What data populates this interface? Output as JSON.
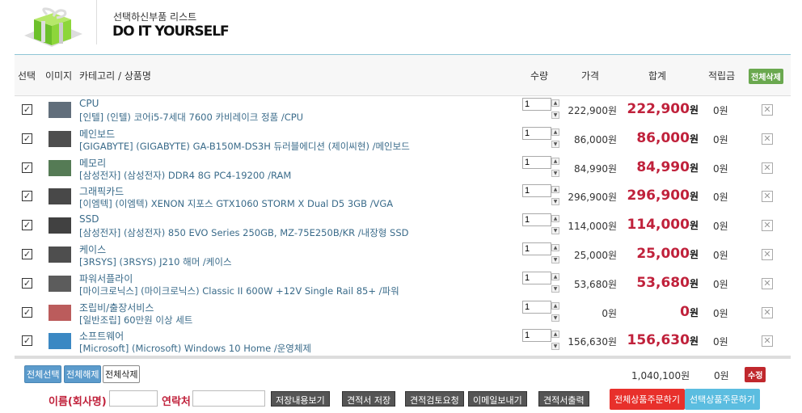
{
  "header": {
    "subtitle": "선택하신부품 리스트",
    "title": "DO IT YOURSELF"
  },
  "columns": {
    "select": "선택",
    "image": "이미지",
    "name": "카테고리 / 상품명",
    "qty": "수량",
    "price": "가격",
    "total": "합계",
    "points": "적립금",
    "delete_all": "전체삭제"
  },
  "items": [
    {
      "category": "CPU",
      "name": "[인텔] (인텔) 코어i5-7세대 7600 카비레이크 정품 /CPU",
      "qty": "1",
      "price": "222,900원",
      "total": "222,900",
      "points": "0원"
    },
    {
      "category": "메인보드",
      "name": "[GIGABYTE] (GIGABYTE) GA-B150M-DS3H 듀러블에디션 (제이씨현) /메인보드",
      "qty": "1",
      "price": "86,000원",
      "total": "86,000",
      "points": "0원"
    },
    {
      "category": "메모리",
      "name": "[삼성전자] (삼성전자) DDR4 8G PC4-19200 /RAM",
      "qty": "1",
      "price": "84,990원",
      "total": "84,990",
      "points": "0원"
    },
    {
      "category": "그래픽카드",
      "name": "[이엠텍] (이엠텍) XENON 지포스 GTX1060 STORM X Dual D5 3GB /VGA",
      "qty": "1",
      "price": "296,900원",
      "total": "296,900",
      "points": "0원"
    },
    {
      "category": "SSD",
      "name": "[삼성전자] (삼성전자) 850 EVO Series 250GB, MZ-75E250B/KR /내장형 SSD",
      "qty": "1",
      "price": "114,000원",
      "total": "114,000",
      "points": "0원"
    },
    {
      "category": "케이스",
      "name": "[3RSYS] (3RSYS) J210 해머 /케이스",
      "qty": "1",
      "price": "25,000원",
      "total": "25,000",
      "points": "0원"
    },
    {
      "category": "파워서플라이",
      "name": "[마이크로닉스] (마이크로닉스) Classic II 600W +12V Single Rail 85+ /파워",
      "qty": "1",
      "price": "53,680원",
      "total": "53,680",
      "points": "0원"
    },
    {
      "category": "조립비/출장서비스",
      "name": "[일반조립] 60만원 이상 세트",
      "qty": "1",
      "price": "0원",
      "total": "0",
      "points": "0원"
    },
    {
      "category": "소프트웨어",
      "name": "[Microsoft] (Microsoft) Windows 10 Home /운영체제",
      "qty": "1",
      "price": "156,630원",
      "total": "156,630",
      "points": "0원"
    }
  ],
  "won": "원",
  "footer": {
    "select_all": "전체선택",
    "deselect_all": "전체해제",
    "delete_all": "전체삭제",
    "sum_total": "1,040,100원",
    "sum_points": "0원",
    "modify": "수정",
    "name_label": "이름(회사명)",
    "contact_label": "연락처",
    "name_value": "",
    "contact_value": "",
    "buttons": [
      "저장내용보기",
      "견적서 저장",
      "견적검토요청",
      "이메일보내기",
      "견적서출력"
    ],
    "order_all": "전체상품주문하기",
    "order_selected": "선택상품주문하기"
  }
}
